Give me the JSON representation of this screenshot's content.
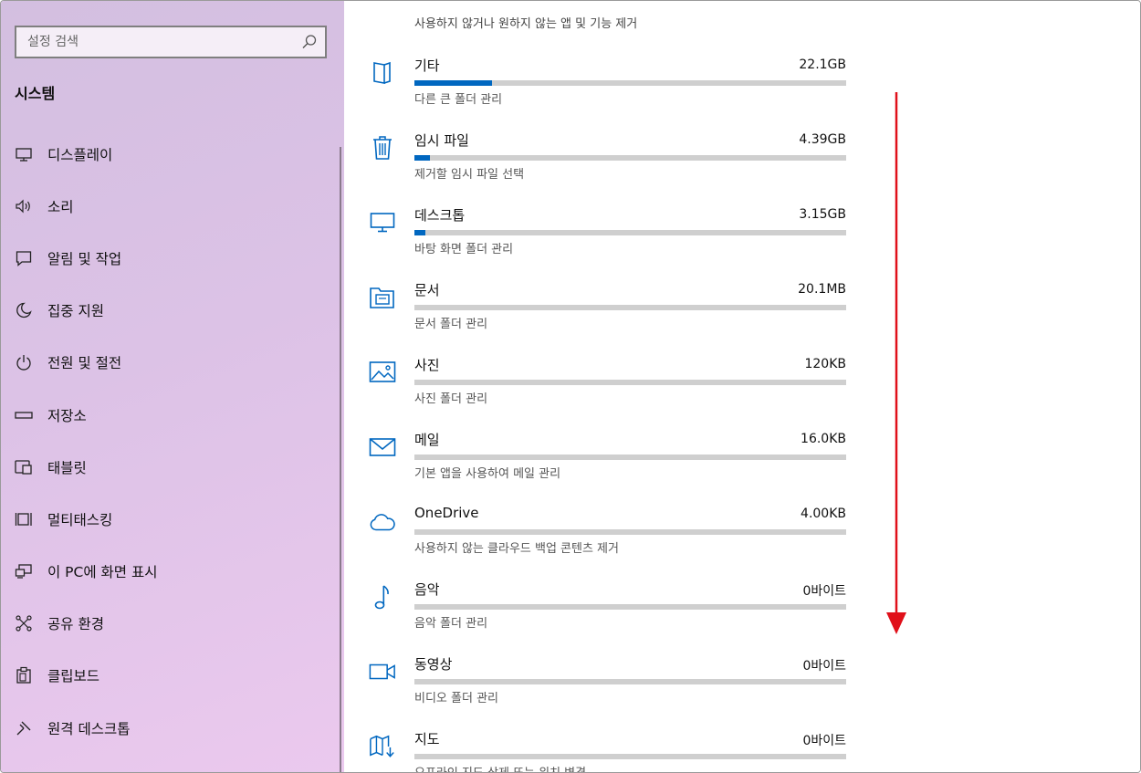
{
  "search": {
    "placeholder": "설정 검색"
  },
  "sidebar": {
    "heading": "시스템",
    "items": [
      {
        "label": "디스플레이",
        "icon": "monitor-icon"
      },
      {
        "label": "소리",
        "icon": "speaker-icon"
      },
      {
        "label": "알림 및 작업",
        "icon": "notification-icon"
      },
      {
        "label": "집중 지원",
        "icon": "moon-icon"
      },
      {
        "label": "전원 및 절전",
        "icon": "power-icon"
      },
      {
        "label": "저장소",
        "icon": "storage-icon"
      },
      {
        "label": "태블릿",
        "icon": "tablet-icon"
      },
      {
        "label": "멀티태스킹",
        "icon": "multitasking-icon"
      },
      {
        "label": "이 PC에 화면 표시",
        "icon": "project-icon"
      },
      {
        "label": "공유 환경",
        "icon": "share-icon"
      },
      {
        "label": "클립보드",
        "icon": "clipboard-icon"
      },
      {
        "label": "원격 데스크톱",
        "icon": "remote-desktop-icon"
      }
    ]
  },
  "main": {
    "top_text": "사용하지 않거나 원하지 않는 앱 및 기능 제거",
    "rows": [
      {
        "name": "기타",
        "size": "22.1GB",
        "desc": "다른 큰 폴더 관리",
        "fill": 0.18,
        "icon": "other-folder-icon"
      },
      {
        "name": "임시 파일",
        "size": "4.39GB",
        "desc": "제거할 임시 파일 선택",
        "fill": 0.036,
        "icon": "trash-icon"
      },
      {
        "name": "데스크톱",
        "size": "3.15GB",
        "desc": "바탕 화면 폴더 관리",
        "fill": 0.025,
        "icon": "desktop-icon"
      },
      {
        "name": "문서",
        "size": "20.1MB",
        "desc": "문서 폴더 관리",
        "fill": 0,
        "icon": "documents-icon"
      },
      {
        "name": "사진",
        "size": "120KB",
        "desc": "사진 폴더 관리",
        "fill": 0,
        "icon": "pictures-icon"
      },
      {
        "name": "메일",
        "size": "16.0KB",
        "desc": "기본 앱을 사용하여 메일 관리",
        "fill": 0,
        "icon": "mail-icon"
      },
      {
        "name": "OneDrive",
        "size": "4.00KB",
        "desc": "사용하지 않는 클라우드 백업 콘텐츠 제거",
        "fill": 0,
        "icon": "cloud-icon"
      },
      {
        "name": "음악",
        "size": "0바이트",
        "desc": "음악 폴더 관리",
        "fill": 0,
        "icon": "music-icon"
      },
      {
        "name": "동영상",
        "size": "0바이트",
        "desc": "비디오 폴더 관리",
        "fill": 0,
        "icon": "video-icon"
      },
      {
        "name": "지도",
        "size": "0바이트",
        "desc": "오프라인 지도 삭제 또는 위치 변경",
        "fill": 0,
        "icon": "map-icon"
      }
    ]
  },
  "colors": {
    "accent": "#0067c0",
    "annotation": "#e0101a"
  }
}
